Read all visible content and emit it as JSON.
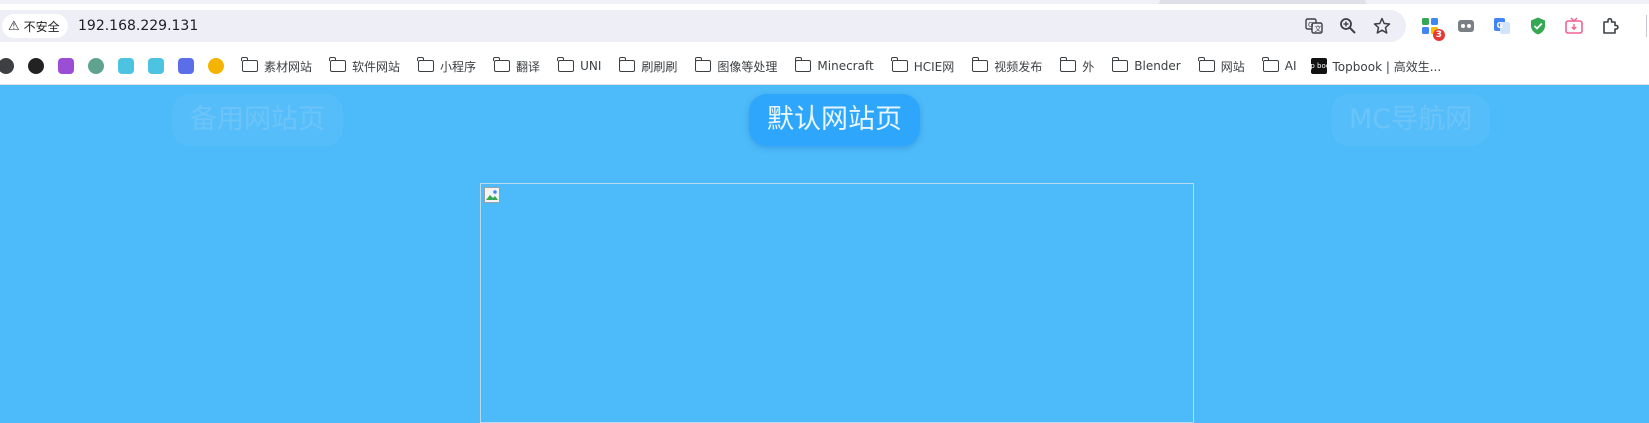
{
  "browser": {
    "security_label": "不安全",
    "url": "192.168.229.131",
    "extension_badge": "3"
  },
  "bookmarks": [
    {
      "type": "favicon",
      "name": "bookmark-favicon-1",
      "color": "#3c4043"
    },
    {
      "type": "favicon",
      "name": "bookmark-favicon-2",
      "color": "#222222"
    },
    {
      "type": "favicon",
      "name": "bookmark-favicon-3",
      "color": "#9c4dd6"
    },
    {
      "type": "favicon",
      "name": "bookmark-favicon-4",
      "color": "#5fa38e"
    },
    {
      "type": "favicon",
      "name": "bookmark-favicon-5",
      "color": "#4cc3e0"
    },
    {
      "type": "favicon",
      "name": "bookmark-favicon-6",
      "color": "#4cc3e0"
    },
    {
      "type": "favicon",
      "name": "bookmark-favicon-7",
      "color": "#5b6ee8"
    },
    {
      "type": "favicon",
      "name": "bookmark-favicon-8",
      "color": "#f4b400"
    },
    {
      "type": "folder",
      "label": "素材网站"
    },
    {
      "type": "folder",
      "label": "软件网站"
    },
    {
      "type": "folder",
      "label": "小程序"
    },
    {
      "type": "folder",
      "label": "翻译"
    },
    {
      "type": "folder",
      "label": "UNI"
    },
    {
      "type": "folder",
      "label": "刷刷刷"
    },
    {
      "type": "folder",
      "label": "图像等处理"
    },
    {
      "type": "folder",
      "label": "Minecraft"
    },
    {
      "type": "folder",
      "label": "HCIE网"
    },
    {
      "type": "folder",
      "label": "视频发布"
    },
    {
      "type": "folder",
      "label": "外"
    },
    {
      "type": "folder",
      "label": "Blender"
    },
    {
      "type": "folder",
      "label": "网站"
    },
    {
      "type": "folder",
      "label": "AI"
    },
    {
      "type": "site",
      "label": "Topbook | 高效生...",
      "favicon_text": "Top book"
    }
  ],
  "page": {
    "nav_left": "备用网站页",
    "nav_center": "默认网站页",
    "nav_right": "MC导航网"
  },
  "colors": {
    "page_bg": "#4dbaf9",
    "active_button": "#2ea6fb"
  }
}
